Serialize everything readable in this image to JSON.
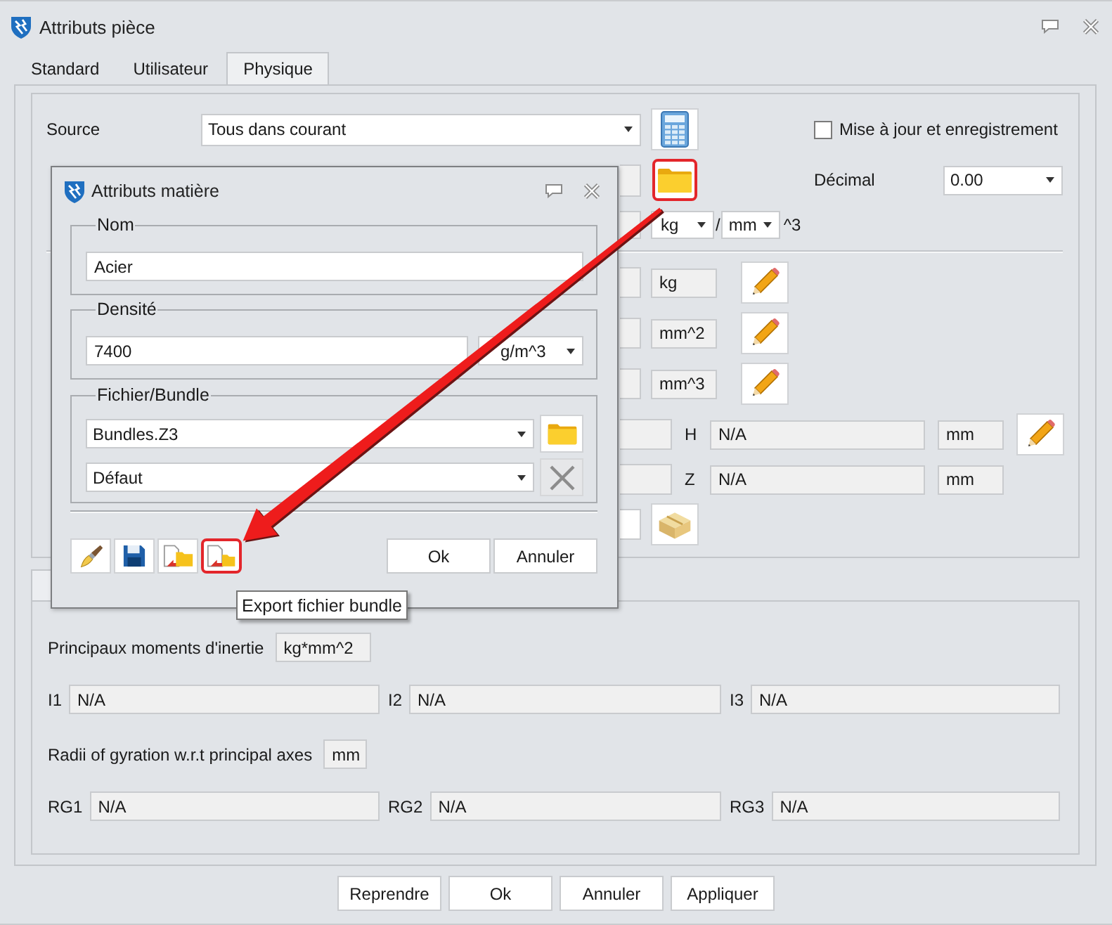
{
  "window": {
    "title": "Attributs pièce"
  },
  "tabs": [
    {
      "label": "Standard",
      "selected": false
    },
    {
      "label": "Utilisateur",
      "selected": false
    },
    {
      "label": "Physique",
      "selected": true
    }
  ],
  "physique": {
    "source": {
      "label": "Source",
      "value": "Tous dans courant"
    },
    "save_checkbox": {
      "label": "Mise à jour et enregistrement",
      "checked": false
    },
    "material_button": {
      "highlighted": true
    },
    "decimal": {
      "label": "Décimal",
      "value": "0.00"
    },
    "density_unit": {
      "mass": "kg",
      "separator": "/",
      "length": "mm",
      "power": "^3"
    },
    "quantities": [
      {
        "kind": "unit",
        "unit": "kg",
        "edit_button": true
      },
      {
        "kind": "unit",
        "unit": "mm^2",
        "edit_button": true
      },
      {
        "kind": "unit",
        "unit": "mm^3",
        "edit_button": true
      },
      {
        "kind": "axis",
        "axis": "H",
        "value": "N/A",
        "unit": "mm",
        "edit_button": true
      },
      {
        "kind": "axis",
        "axis": "Z",
        "value": "N/A",
        "unit": "mm",
        "edit_button": false
      },
      {
        "kind": "box",
        "edit_button": false
      }
    ]
  },
  "inertia": {
    "label": "Principaux moments d'inertie",
    "unit": "kg*mm^2",
    "moments": [
      {
        "label": "I1",
        "value": "N/A"
      },
      {
        "label": "I2",
        "value": "N/A"
      },
      {
        "label": "I3",
        "value": "N/A"
      }
    ],
    "gyration_label": "Radii of gyration w.r.t principal axes",
    "gyration_unit": "mm",
    "radii": [
      {
        "label": "RG1",
        "value": "N/A"
      },
      {
        "label": "RG2",
        "value": "N/A"
      },
      {
        "label": "RG3",
        "value": "N/A"
      }
    ]
  },
  "buttons": [
    "Reprendre",
    "Ok",
    "Annuler",
    "Appliquer"
  ],
  "material_dialog": {
    "title": "Attributs matière",
    "name": {
      "legend": "Nom",
      "value": "Acier"
    },
    "density": {
      "legend": "Densité",
      "value": "7400",
      "unit": "g/m^3"
    },
    "bundle": {
      "legend": "Fichier/Bundle",
      "file": "Bundles.Z3",
      "entry": "Défaut",
      "buttons": [
        {
          "kind": "folder",
          "disabled": false
        },
        {
          "kind": "delete",
          "disabled": true
        }
      ]
    },
    "toolbar": [
      {
        "kind": "brush",
        "highlighted": false
      },
      {
        "kind": "save",
        "highlighted": false
      },
      {
        "kind": "import",
        "highlighted": false
      },
      {
        "kind": "export",
        "highlighted": true
      }
    ],
    "buttons": [
      "Ok",
      "Annuler"
    ]
  },
  "tooltip": "Export fichier bundle"
}
